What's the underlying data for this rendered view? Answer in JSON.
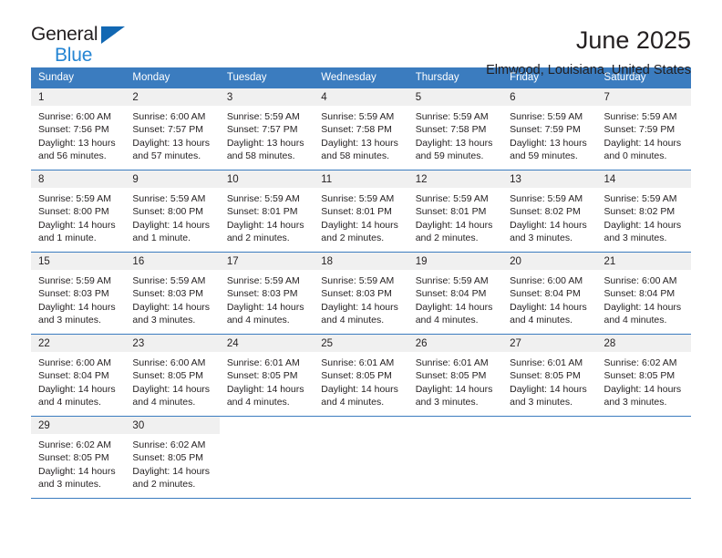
{
  "logo": {
    "primary_text": "General",
    "secondary_text": "Blue",
    "triangle_color": "#1268b3",
    "secondary_color": "#2585d3"
  },
  "header": {
    "title": "June 2025",
    "subtitle": "Elmwood, Louisiana, United States"
  },
  "theme": {
    "header_blue": "#3b7cbf",
    "daynum_background": "#f0f0f0",
    "text_color": "#231f20"
  },
  "calendar": {
    "weekday_headers": [
      "Sunday",
      "Monday",
      "Tuesday",
      "Wednesday",
      "Thursday",
      "Friday",
      "Saturday"
    ],
    "weeks": [
      [
        {
          "day": "1",
          "sunrise": "Sunrise: 6:00 AM",
          "sunset": "Sunset: 7:56 PM",
          "daylight": "Daylight: 13 hours and 56 minutes."
        },
        {
          "day": "2",
          "sunrise": "Sunrise: 6:00 AM",
          "sunset": "Sunset: 7:57 PM",
          "daylight": "Daylight: 13 hours and 57 minutes."
        },
        {
          "day": "3",
          "sunrise": "Sunrise: 5:59 AM",
          "sunset": "Sunset: 7:57 PM",
          "daylight": "Daylight: 13 hours and 58 minutes."
        },
        {
          "day": "4",
          "sunrise": "Sunrise: 5:59 AM",
          "sunset": "Sunset: 7:58 PM",
          "daylight": "Daylight: 13 hours and 58 minutes."
        },
        {
          "day": "5",
          "sunrise": "Sunrise: 5:59 AM",
          "sunset": "Sunset: 7:58 PM",
          "daylight": "Daylight: 13 hours and 59 minutes."
        },
        {
          "day": "6",
          "sunrise": "Sunrise: 5:59 AM",
          "sunset": "Sunset: 7:59 PM",
          "daylight": "Daylight: 13 hours and 59 minutes."
        },
        {
          "day": "7",
          "sunrise": "Sunrise: 5:59 AM",
          "sunset": "Sunset: 7:59 PM",
          "daylight": "Daylight: 14 hours and 0 minutes."
        }
      ],
      [
        {
          "day": "8",
          "sunrise": "Sunrise: 5:59 AM",
          "sunset": "Sunset: 8:00 PM",
          "daylight": "Daylight: 14 hours and 1 minute."
        },
        {
          "day": "9",
          "sunrise": "Sunrise: 5:59 AM",
          "sunset": "Sunset: 8:00 PM",
          "daylight": "Daylight: 14 hours and 1 minute."
        },
        {
          "day": "10",
          "sunrise": "Sunrise: 5:59 AM",
          "sunset": "Sunset: 8:01 PM",
          "daylight": "Daylight: 14 hours and 2 minutes."
        },
        {
          "day": "11",
          "sunrise": "Sunrise: 5:59 AM",
          "sunset": "Sunset: 8:01 PM",
          "daylight": "Daylight: 14 hours and 2 minutes."
        },
        {
          "day": "12",
          "sunrise": "Sunrise: 5:59 AM",
          "sunset": "Sunset: 8:01 PM",
          "daylight": "Daylight: 14 hours and 2 minutes."
        },
        {
          "day": "13",
          "sunrise": "Sunrise: 5:59 AM",
          "sunset": "Sunset: 8:02 PM",
          "daylight": "Daylight: 14 hours and 3 minutes."
        },
        {
          "day": "14",
          "sunrise": "Sunrise: 5:59 AM",
          "sunset": "Sunset: 8:02 PM",
          "daylight": "Daylight: 14 hours and 3 minutes."
        }
      ],
      [
        {
          "day": "15",
          "sunrise": "Sunrise: 5:59 AM",
          "sunset": "Sunset: 8:03 PM",
          "daylight": "Daylight: 14 hours and 3 minutes."
        },
        {
          "day": "16",
          "sunrise": "Sunrise: 5:59 AM",
          "sunset": "Sunset: 8:03 PM",
          "daylight": "Daylight: 14 hours and 3 minutes."
        },
        {
          "day": "17",
          "sunrise": "Sunrise: 5:59 AM",
          "sunset": "Sunset: 8:03 PM",
          "daylight": "Daylight: 14 hours and 4 minutes."
        },
        {
          "day": "18",
          "sunrise": "Sunrise: 5:59 AM",
          "sunset": "Sunset: 8:03 PM",
          "daylight": "Daylight: 14 hours and 4 minutes."
        },
        {
          "day": "19",
          "sunrise": "Sunrise: 5:59 AM",
          "sunset": "Sunset: 8:04 PM",
          "daylight": "Daylight: 14 hours and 4 minutes."
        },
        {
          "day": "20",
          "sunrise": "Sunrise: 6:00 AM",
          "sunset": "Sunset: 8:04 PM",
          "daylight": "Daylight: 14 hours and 4 minutes."
        },
        {
          "day": "21",
          "sunrise": "Sunrise: 6:00 AM",
          "sunset": "Sunset: 8:04 PM",
          "daylight": "Daylight: 14 hours and 4 minutes."
        }
      ],
      [
        {
          "day": "22",
          "sunrise": "Sunrise: 6:00 AM",
          "sunset": "Sunset: 8:04 PM",
          "daylight": "Daylight: 14 hours and 4 minutes."
        },
        {
          "day": "23",
          "sunrise": "Sunrise: 6:00 AM",
          "sunset": "Sunset: 8:05 PM",
          "daylight": "Daylight: 14 hours and 4 minutes."
        },
        {
          "day": "24",
          "sunrise": "Sunrise: 6:01 AM",
          "sunset": "Sunset: 8:05 PM",
          "daylight": "Daylight: 14 hours and 4 minutes."
        },
        {
          "day": "25",
          "sunrise": "Sunrise: 6:01 AM",
          "sunset": "Sunset: 8:05 PM",
          "daylight": "Daylight: 14 hours and 4 minutes."
        },
        {
          "day": "26",
          "sunrise": "Sunrise: 6:01 AM",
          "sunset": "Sunset: 8:05 PM",
          "daylight": "Daylight: 14 hours and 3 minutes."
        },
        {
          "day": "27",
          "sunrise": "Sunrise: 6:01 AM",
          "sunset": "Sunset: 8:05 PM",
          "daylight": "Daylight: 14 hours and 3 minutes."
        },
        {
          "day": "28",
          "sunrise": "Sunrise: 6:02 AM",
          "sunset": "Sunset: 8:05 PM",
          "daylight": "Daylight: 14 hours and 3 minutes."
        }
      ],
      [
        {
          "day": "29",
          "sunrise": "Sunrise: 6:02 AM",
          "sunset": "Sunset: 8:05 PM",
          "daylight": "Daylight: 14 hours and 3 minutes."
        },
        {
          "day": "30",
          "sunrise": "Sunrise: 6:02 AM",
          "sunset": "Sunset: 8:05 PM",
          "daylight": "Daylight: 14 hours and 2 minutes."
        },
        {
          "day": "",
          "sunrise": "",
          "sunset": "",
          "daylight": ""
        },
        {
          "day": "",
          "sunrise": "",
          "sunset": "",
          "daylight": ""
        },
        {
          "day": "",
          "sunrise": "",
          "sunset": "",
          "daylight": ""
        },
        {
          "day": "",
          "sunrise": "",
          "sunset": "",
          "daylight": ""
        },
        {
          "day": "",
          "sunrise": "",
          "sunset": "",
          "daylight": ""
        }
      ]
    ]
  }
}
